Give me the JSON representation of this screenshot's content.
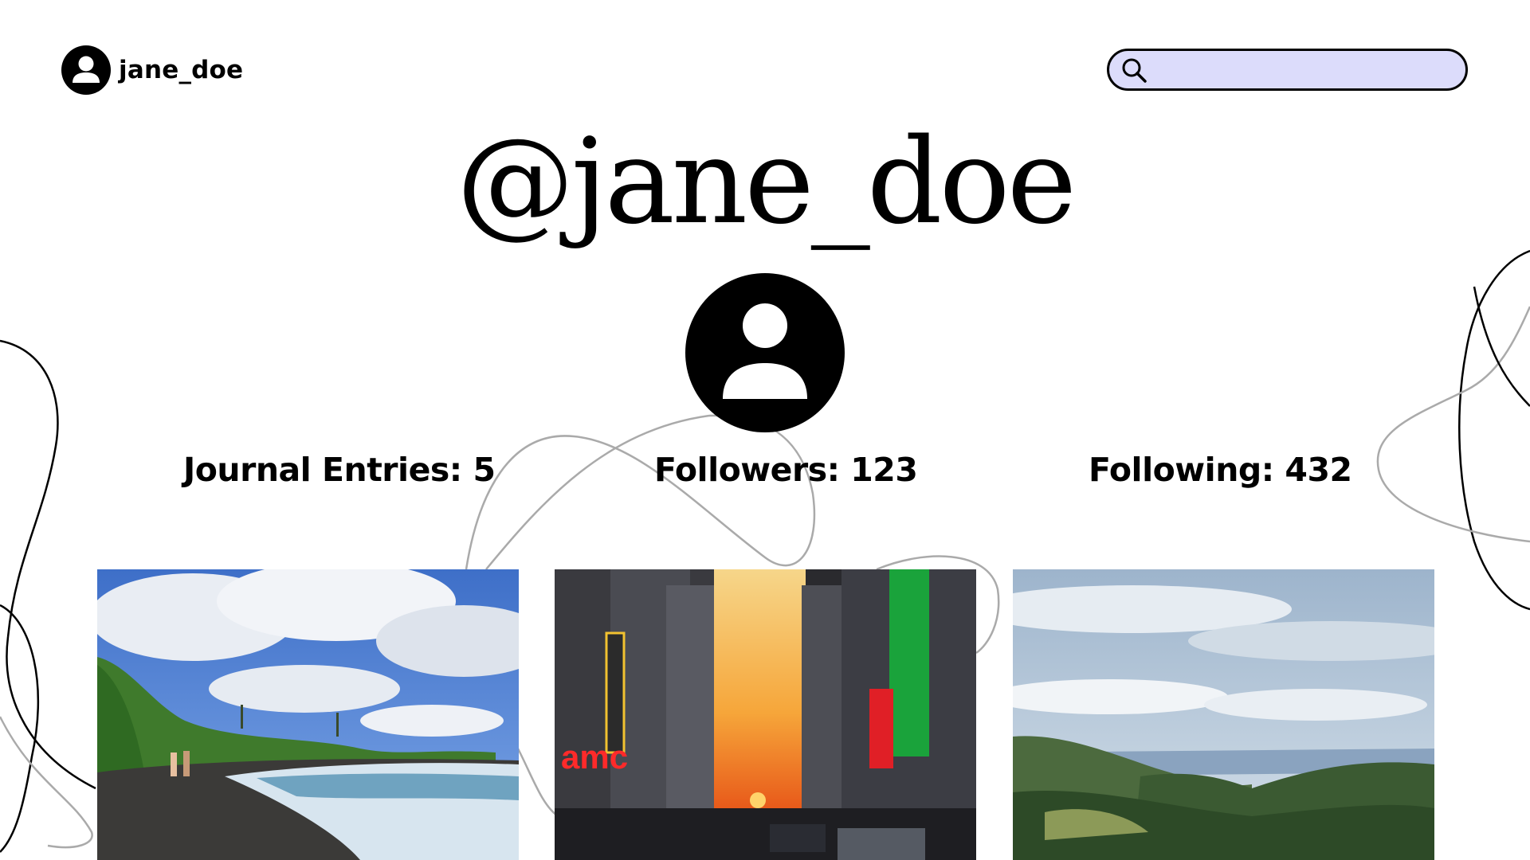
{
  "header": {
    "username": "jane_doe",
    "avatar_icon": "user-circle-icon"
  },
  "search": {
    "placeholder": "",
    "value": "",
    "icon": "search-icon",
    "background_color": "#dcdcfb"
  },
  "profile": {
    "title": "@jane_doe",
    "avatar_icon": "user-circle-icon"
  },
  "stats": {
    "entries_label": "Journal Entries: 5",
    "followers_label": "Followers: 123",
    "following_label": "Following: 432"
  },
  "photos": [
    {
      "subject": "black sand beach with ocean waves and cloudy blue sky"
    },
    {
      "subject": "city street at sunset with neon theater signs"
    },
    {
      "subject": "forested mountain valley under cloudy sky"
    }
  ]
}
